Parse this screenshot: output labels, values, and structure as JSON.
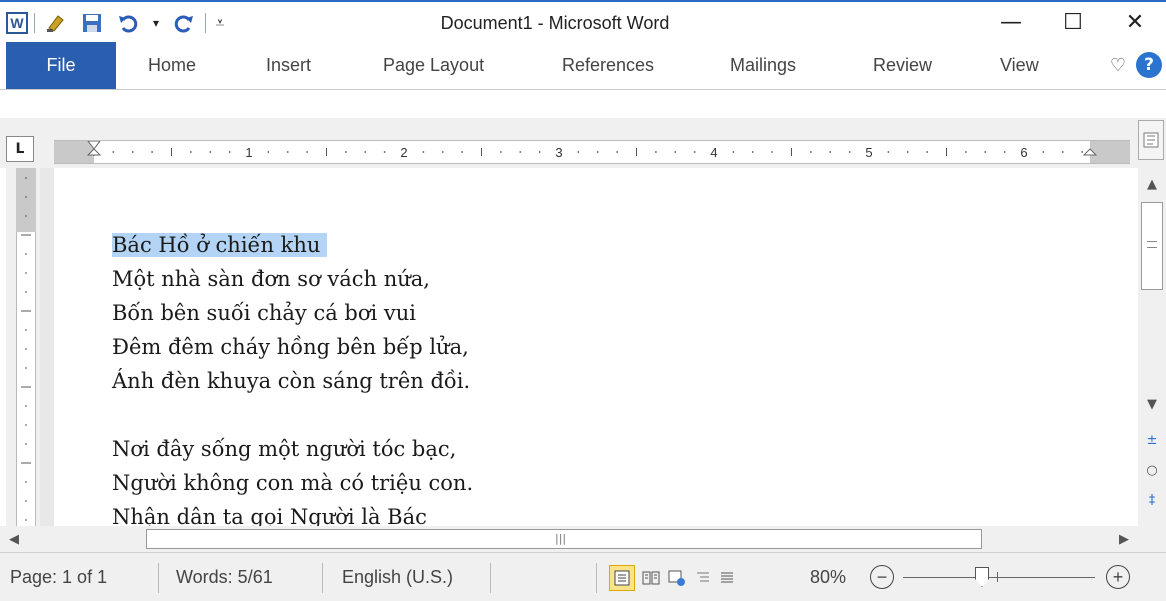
{
  "window": {
    "title": "Document1 - Microsoft Word",
    "controls": {
      "minimize": "—",
      "maximize": "☐",
      "close": "✕"
    }
  },
  "quick_access": {
    "app_icon": "W",
    "items": [
      "word-app-icon",
      "format-painter-icon",
      "save-icon",
      "undo-icon",
      "redo-icon",
      "customize-icon"
    ]
  },
  "ribbon": {
    "file_label": "File",
    "tabs": [
      "Home",
      "Insert",
      "Page Layout",
      "References",
      "Mailings",
      "Review",
      "View"
    ],
    "minimize_glyph": "♡",
    "help_glyph": "?"
  },
  "ruler": {
    "tab_selector": "L",
    "numbers": [
      "1",
      "2",
      "3",
      "4",
      "5",
      "6"
    ]
  },
  "document": {
    "lines": [
      "Bác Hồ ở chiến khu ",
      "Một nhà sàn đơn sơ vách nứa,",
      "Bốn bên suối chảy cá bơi vui",
      "Đêm đêm cháy hồng bên bếp lửa,",
      "Ánh đèn khuya còn sáng trên đồi.",
      "",
      "Nơi đây sống một người tóc bạc,",
      "Người không con mà có triệu con.",
      "Nhận dân ta gọi Người là Bác"
    ],
    "selected_line_index": 0
  },
  "scrollbars": {
    "up": "▲",
    "down": "▼",
    "prev_page": "±",
    "browse": "○",
    "next_page": "‡",
    "left": "◀",
    "right": "▶",
    "grip": "|||"
  },
  "status": {
    "page": "Page: 1 of 1",
    "words": "Words: 5/61",
    "language": "English (U.S.)",
    "zoom": "80%",
    "zoom_out": "−",
    "zoom_in": "+"
  }
}
